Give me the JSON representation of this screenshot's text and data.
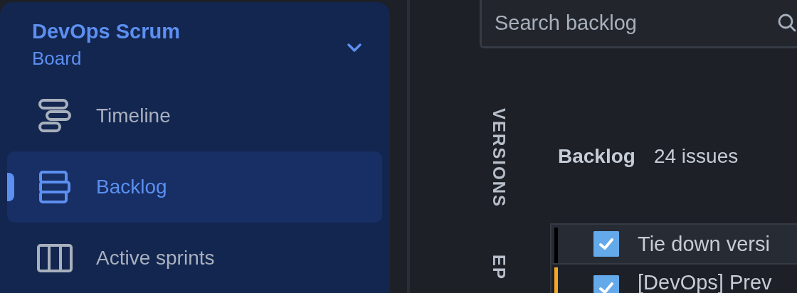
{
  "sidebar": {
    "project": "DevOps Scrum",
    "board": "Board",
    "expanded": false,
    "items": [
      {
        "label": "Timeline",
        "kind": "timeline",
        "selected": false
      },
      {
        "label": "Backlog",
        "kind": "backlog",
        "selected": true
      },
      {
        "label": "Active sprints",
        "kind": "columns",
        "selected": false
      }
    ]
  },
  "search": {
    "placeholder": "Search backlog"
  },
  "side_tabs": [
    "VERSIONS",
    "EP"
  ],
  "backlog": {
    "title": "Backlog",
    "count": "24 issues",
    "rows": [
      {
        "title": "Tie down versi",
        "checked": true,
        "color": "#000000"
      },
      {
        "title": "[DevOps] Prev",
        "checked": true,
        "color": "#f5a623"
      }
    ]
  }
}
